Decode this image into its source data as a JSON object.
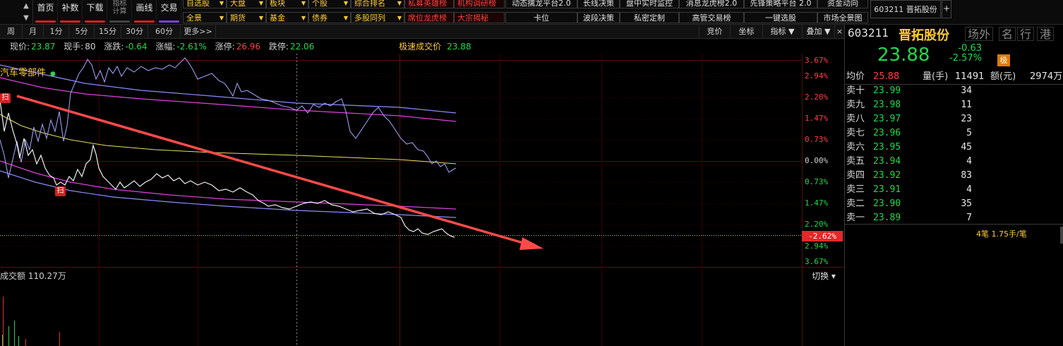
{
  "toolbar": {
    "buttons": [
      "首页",
      "补数",
      "下载",
      "指标\n计算",
      "画线",
      "交易"
    ],
    "row1": [
      "自选股",
      "大盘",
      "板块",
      "个股",
      "综合排名",
      "私募英雄榜",
      "机构调研榜",
      "动态擒龙平台2.0",
      "长线决策",
      "盘中实时监控",
      "消息龙虎榜2.0",
      "先锋策略平台 2.0",
      "资金动向"
    ],
    "row2": [
      "全景",
      "期货",
      "基金",
      "债券",
      "多股同列",
      "席位龙虎榜",
      "大宗揭秘",
      "卡位",
      "波段决策",
      "私密定制",
      "高管交易榜",
      "一键选股",
      "市场全景图"
    ],
    "stock_tab": "603211  晋拓股份",
    "add_tab": "+"
  },
  "period_bar": {
    "periods": [
      "周",
      "月",
      "1分",
      "5分",
      "15分",
      "30分",
      "60分",
      "更多>>"
    ],
    "tools": [
      "竞价",
      "坐标",
      "指标 ▼",
      "叠加 ▼"
    ],
    "close": "×"
  },
  "info": {
    "price_label": "现价:",
    "price": "23.87",
    "hand_label": "现手:",
    "hand": "80",
    "change_label": "涨跌:",
    "change": "-0.64",
    "pct_label": "涨幅:",
    "pct": "-2.61%",
    "limit_up_label": "涨停:",
    "limit_up": "26.96",
    "limit_down_label": "跌停:",
    "limit_down": "22.06",
    "fast_label": "极速成交价",
    "fast_price": "23.88"
  },
  "chart": {
    "title_overlay": "汽车零部件",
    "scan_tag": "扫",
    "price_labels": [
      {
        "text": "3.67%",
        "color": "red"
      },
      {
        "text": "2.94%",
        "color": "red"
      },
      {
        "text": "2.20%",
        "color": "red"
      },
      {
        "text": "1.47%",
        "color": "red"
      },
      {
        "text": "0.73%",
        "color": "red"
      },
      {
        "text": "0.00%",
        "color": "white"
      },
      {
        "text": "0.73%",
        "color": "green"
      },
      {
        "text": "1.47%",
        "color": "green"
      },
      {
        "text": "2.20%",
        "color": "green"
      },
      {
        "text": "2.94%",
        "color": "green"
      },
      {
        "text": "3.67%",
        "color": "green"
      }
    ],
    "current_tag": "-2.62%",
    "volume_label": "成交额 110.27万",
    "switch_label": "切换 ▾",
    "colors": {
      "price_line": "#ffffff",
      "avg_line": "#e8e060",
      "band_blue": "#8a8cff",
      "band_magenta": "#e040e0",
      "arrow": "#ff4a4a"
    }
  },
  "panel": {
    "code": "603211",
    "name": "晋拓股份",
    "markets": [
      "场外",
      "名",
      "行",
      "港"
    ],
    "price": "23.88",
    "change": "-0.63",
    "pct": "-2.57%",
    "flag": "极",
    "avg_label": "均价",
    "avg": "25.88",
    "vol_label": "量(手)",
    "vol": "11491",
    "amt_label": "额(元)",
    "amt": "2974万",
    "book": [
      {
        "level": "卖十",
        "price": "23.99",
        "qty": "34"
      },
      {
        "level": "卖九",
        "price": "23.98",
        "qty": "11"
      },
      {
        "level": "卖八",
        "price": "23.97",
        "qty": "23"
      },
      {
        "level": "卖七",
        "price": "23.96",
        "qty": "5"
      },
      {
        "level": "卖六",
        "price": "23.95",
        "qty": "45"
      },
      {
        "level": "卖五",
        "price": "23.94",
        "qty": "4"
      },
      {
        "level": "卖四",
        "price": "23.92",
        "qty": "83"
      },
      {
        "level": "卖三",
        "price": "23.91",
        "qty": "4"
      },
      {
        "level": "卖二",
        "price": "23.90",
        "qty": "35"
      },
      {
        "level": "卖一",
        "price": "23.89",
        "qty": "7"
      }
    ],
    "trade_note": "4笔 1.75手/笔"
  }
}
